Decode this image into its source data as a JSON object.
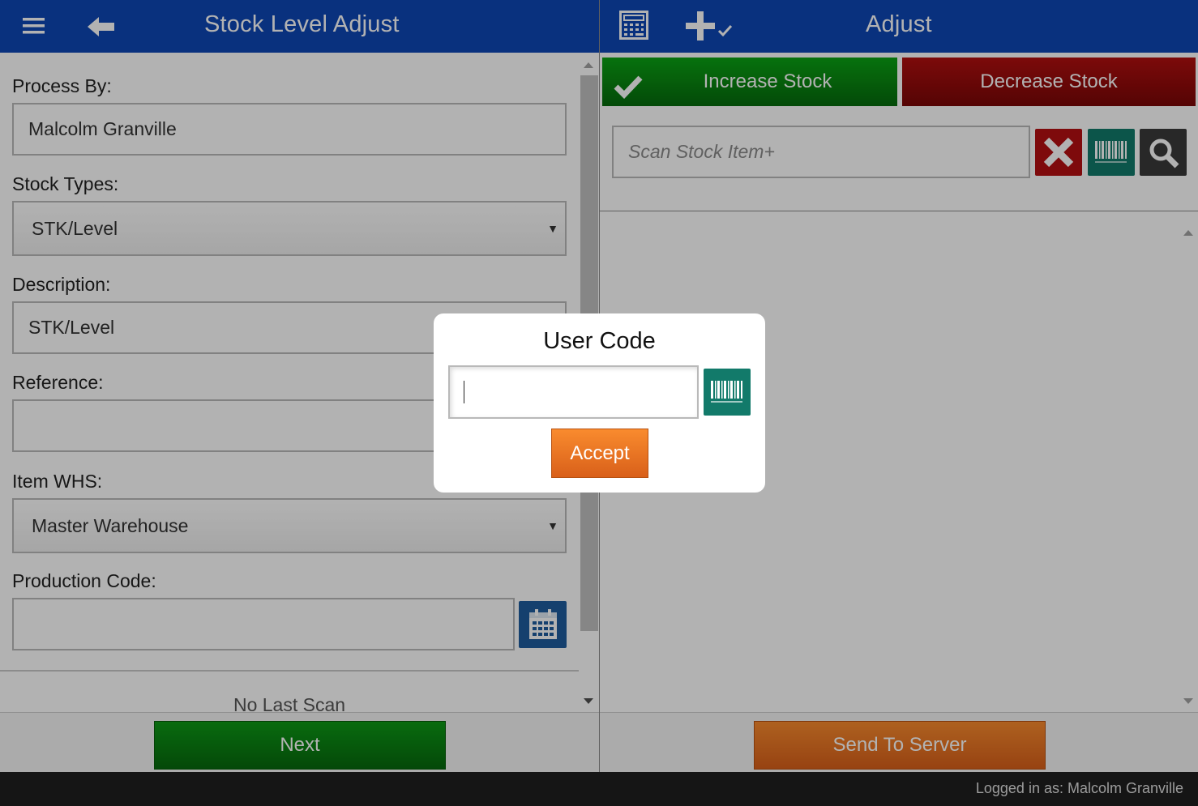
{
  "header_left": {
    "title": "Stock Level Adjust",
    "menu_icon": "hamburger-menu-icon",
    "back_icon": "back-arrow-icon"
  },
  "header_right": {
    "title": "Adjust",
    "keypad_icon": "keypad-icon",
    "add_check_icon": "add-check-icon"
  },
  "form": {
    "process_by_label": "Process By:",
    "process_by_value": "Malcolm Granville",
    "stock_types_label": "Stock Types:",
    "stock_types_value": "STK/Level",
    "description_label": "Description:",
    "description_value": "STK/Level",
    "reference_label": "Reference:",
    "reference_value": "",
    "item_whs_label": "Item WHS:",
    "item_whs_value": "Master Warehouse",
    "production_code_label": "Production Code:",
    "production_code_value": "",
    "last_scan_text": "No Last Scan"
  },
  "adjust": {
    "increase_label": "Increase Stock",
    "decrease_label": "Decrease Stock",
    "scan_placeholder": "Scan Stock Item+"
  },
  "footer_left": {
    "next_label": "Next"
  },
  "footer_right": {
    "send_label": "Send To Server"
  },
  "status": {
    "logged_in_text": "Logged in as: Malcolm Granville"
  },
  "dialog": {
    "title": "User Code",
    "input_value": "",
    "accept_label": "Accept"
  },
  "colors": {
    "header_blue": "#0e47b5",
    "green": "#0ba314",
    "red": "#b20f0f",
    "orange": "#f98b2e",
    "teal": "#127a6a"
  }
}
